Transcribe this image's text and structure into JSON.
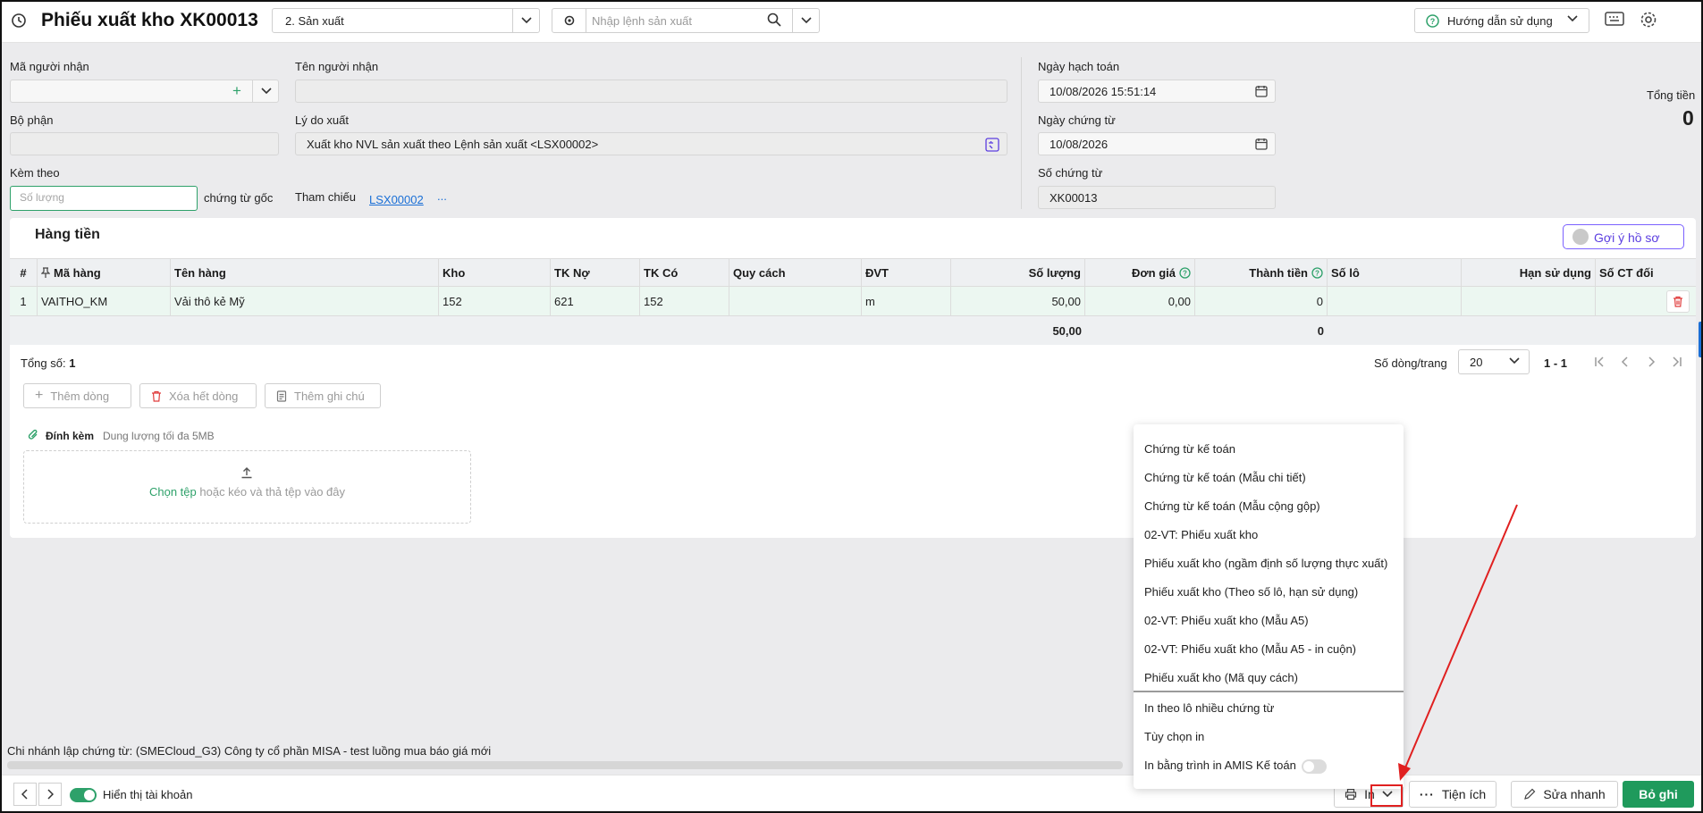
{
  "header": {
    "title": "Phiếu xuất kho XK00013",
    "export_type": "2. Sản xuất",
    "command_placeholder": "Nhập lệnh sản xuất",
    "help_label": "Hướng dẫn sử dụng"
  },
  "form": {
    "recipient_code_label": "Mã người nhận",
    "recipient_code_value": "",
    "recipient_name_label": "Tên người nhận",
    "recipient_name_value": "",
    "department_label": "Bộ phận",
    "department_value": "",
    "reason_label": "Lý do xuất",
    "reason_value": "Xuất kho NVL sản xuất theo Lệnh sản xuất <LSX00002>",
    "attach_label": "Kèm theo",
    "attach_placeholder": "Số lượng",
    "attach_suffix": "chứng từ gốc",
    "reference_label": "Tham chiếu",
    "reference_value": "LSX00002",
    "reference_more": "...",
    "posting_date_label": "Ngày hạch toán",
    "posting_date_value": "10/08/2026 15:51:14",
    "voucher_date_label": "Ngày chứng từ",
    "voucher_date_value": "10/08/2026",
    "voucher_no_label": "Số chứng từ",
    "voucher_no_value": "XK00013",
    "total_label": "Tổng tiền",
    "total_value": "0"
  },
  "section": {
    "title": "Hàng tiền",
    "suggest_label": "Gợi ý hồ sơ"
  },
  "table": {
    "columns": [
      "#",
      "Mã hàng",
      "Tên hàng",
      "Kho",
      "TK Nợ",
      "TK Có",
      "Quy cách",
      "ĐVT",
      "Số lượng",
      "Đơn giá",
      "Thành tiền",
      "Số lô",
      "Hạn sử dụng",
      "Số CT đối"
    ],
    "rows": [
      [
        "1",
        "VAITHO_KM",
        "Vải thô kẻ Mỹ",
        "152",
        "621",
        "152",
        "",
        "m",
        "50,00",
        "0,00",
        "0",
        "",
        "",
        ""
      ]
    ],
    "footer": {
      "quantity_total": "50,00",
      "amount_total": "0"
    }
  },
  "pager": {
    "count_label": "Tổng số:",
    "count_value": "1",
    "rows_per_page_label": "Số dòng/trang",
    "rows_per_page": "20",
    "range": "1 - 1"
  },
  "actions": {
    "add_row": "Thêm dòng",
    "delete_all": "Xóa hết dòng",
    "add_note": "Thêm ghi chú"
  },
  "attachment": {
    "label": "Đính kèm",
    "hint": "Dung lượng tối đa 5MB",
    "choose": "Chọn tệp",
    "drop_text": "hoặc kéo và thả tệp vào đây"
  },
  "footer": {
    "branch_text": "Chi nhánh lập chứng từ: (SMECloud_G3) Công ty cổ phần MISA - test luồng mua báo giá mới",
    "show_accounts": "Hiển thị tài khoản",
    "print_label": "In",
    "utilities_label": "Tiện ích",
    "quick_edit_label": "Sửa nhanh",
    "ignore_label": "Bỏ ghi"
  },
  "print_menu": {
    "items": [
      "Chứng từ kế toán",
      "Chứng từ kế toán (Mẫu chi tiết)",
      "Chứng từ kế toán (Mẫu cộng gộp)",
      "02-VT: Phiếu xuất kho",
      "Phiếu xuất kho (ngầm định số lượng thực xuất)",
      "Phiếu xuất kho (Theo số lô, hạn sử dụng)",
      "02-VT: Phiếu xuất kho (Mẫu A5)",
      "02-VT: Phiếu xuất kho (Mẫu A5 - in cuộn)",
      "Phiếu xuất kho (Mã quy cách)"
    ],
    "extra_items": [
      "In theo lô nhiều chứng từ",
      "Tùy chọn in",
      "In bằng trình in AMIS Kế toán"
    ]
  },
  "colors": {
    "primary": "#1f9a5c",
    "annotation": "#e02020",
    "link": "#1a6fd6",
    "suggest": "#7b61ff"
  }
}
